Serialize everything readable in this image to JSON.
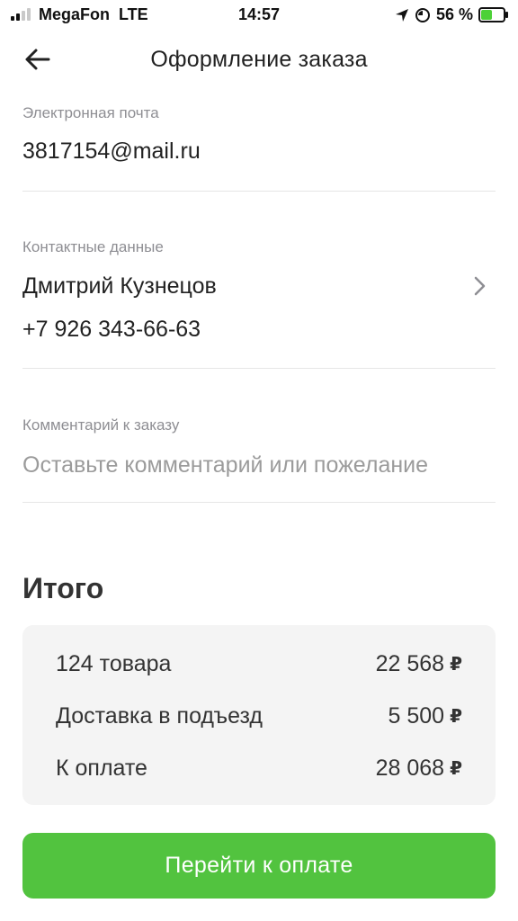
{
  "status_bar": {
    "carrier": "MegaFon",
    "network": "LTE",
    "time": "14:57",
    "battery_percent": "56 %",
    "battery_level": 0.56,
    "icons": [
      "signal-icon",
      "location-icon",
      "timer-icon",
      "battery-icon"
    ]
  },
  "header": {
    "title": "Оформление заказа",
    "back_icon": "arrow-left-icon"
  },
  "email": {
    "label": "Электронная почта",
    "value": "3817154@mail.ru"
  },
  "contact": {
    "label": "Контактные данные",
    "name": "Дмитрий Кузнецов",
    "phone": "+7 926 343-66-63",
    "chevron_icon": "chevron-right-icon"
  },
  "comment": {
    "label": "Комментарий к заказу",
    "placeholder": "Оставьте комментарий или пожелание",
    "value": ""
  },
  "summary": {
    "title": "Итого",
    "currency_symbol": "₽",
    "rows": [
      {
        "label": "124 товара",
        "amount": "22 568"
      },
      {
        "label": "Доставка в подъезд",
        "amount": "5 500"
      },
      {
        "label": "К оплате",
        "amount": "28 068"
      }
    ]
  },
  "pay_button": {
    "label": "Перейти к оплате"
  },
  "colors": {
    "accent_green": "#52c33f",
    "label_gray": "#8e8e93",
    "card_bg": "#f4f4f4",
    "text": "#222222"
  }
}
